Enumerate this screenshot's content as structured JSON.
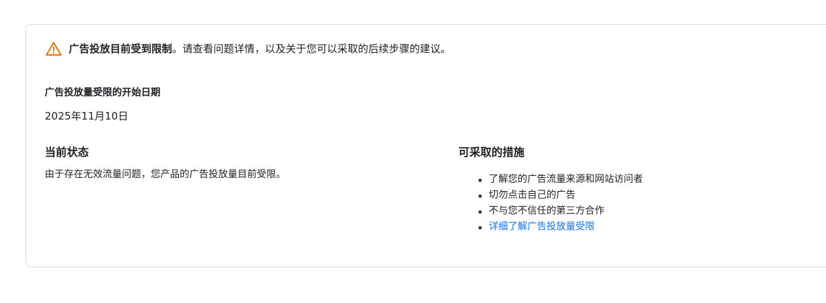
{
  "alert": {
    "icon": "warning-triangle-icon",
    "icon_color": "#e37400",
    "bold_text": "广告投放目前受到限制",
    "rest_text": "。请查看问题详情，以及关于您可以采取的后续步骤的建议。"
  },
  "start": {
    "label": "广告投放量受限的开始日期",
    "date": "2025年11月10日"
  },
  "status": {
    "title": "当前状态",
    "text": "由于存在无效流量问题，您产品的广告投放量目前受限。"
  },
  "actions": {
    "title": "可采取的措施",
    "items": [
      "了解您的广告流量来源和网站访问者",
      "切勿点击自己的广告",
      "不与您不信任的第三方合作"
    ],
    "link_text": "详细了解广告投放量受限",
    "link_color": "#1a73e8"
  }
}
